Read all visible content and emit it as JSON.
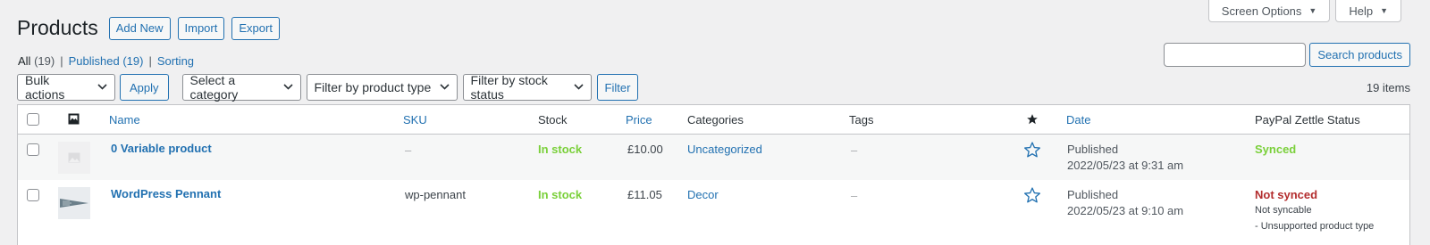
{
  "screen_meta": {
    "screen_options_label": "Screen Options",
    "help_label": "Help"
  },
  "header": {
    "title": "Products",
    "add_new": "Add New",
    "import": "Import",
    "export": "Export"
  },
  "views": {
    "all_label": "All",
    "all_count": "(19)",
    "published_label": "Published",
    "published_count": "(19)",
    "sorting_label": "Sorting",
    "separator": "|"
  },
  "search": {
    "value": "",
    "button": "Search products"
  },
  "tablenav": {
    "bulk_actions": "Bulk actions",
    "apply": "Apply",
    "category": "Select a category",
    "product_type": "Filter by product type",
    "stock_status": "Filter by stock status",
    "filter": "Filter",
    "items_count": "19 items"
  },
  "columns": {
    "name": "Name",
    "sku": "SKU",
    "stock": "Stock",
    "price": "Price",
    "categories": "Categories",
    "tags": "Tags",
    "featured_icon": "star-filled-icon",
    "date": "Date",
    "zettle": "PayPal Zettle Status"
  },
  "rows": [
    {
      "name": "0 Variable product",
      "sku": "–",
      "stock": "In stock",
      "price": "£10.00",
      "categories": "Uncategorized",
      "tags": "–",
      "featured_icon": "star-outline-icon",
      "date_status": "Published",
      "date": "2022/05/23 at 9:31 am",
      "zettle_status": "Synced",
      "zettle_note": "",
      "zettle_reason": ""
    },
    {
      "name": "WordPress Pennant",
      "sku": "wp-pennant",
      "stock": "In stock",
      "price": "£11.05",
      "categories": "Decor",
      "tags": "–",
      "featured_icon": "star-outline-icon",
      "date_status": "Published",
      "date": "2022/05/23 at 9:10 am",
      "zettle_status": "Not synced",
      "zettle_note": "Not syncable",
      "zettle_reason": "- Unsupported product type"
    }
  ],
  "colors": {
    "accent": "#2271b1",
    "in_stock": "#7ad03a",
    "not_synced": "#b32d2e",
    "background": "#f0f0f1"
  }
}
